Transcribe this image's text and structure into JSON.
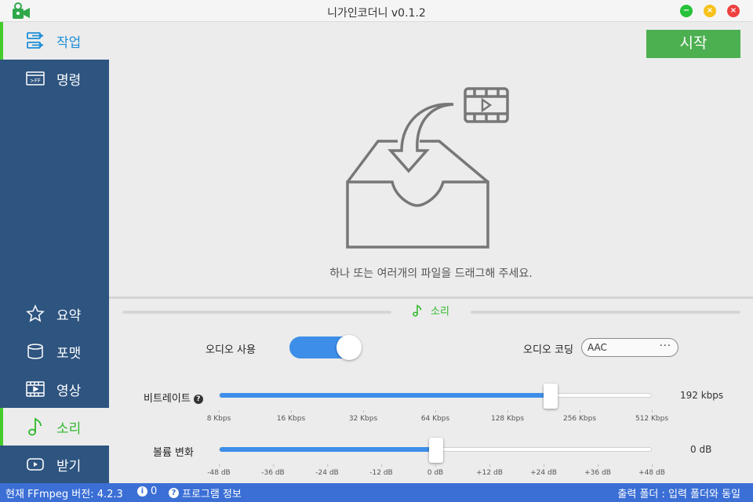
{
  "window": {
    "title": "니가인코더니 v0.1.2"
  },
  "sidebar": {
    "items": [
      {
        "label": "작업",
        "icon": "task-icon",
        "active": true
      },
      {
        "label": "명령",
        "icon": "ffmpeg-command-icon"
      },
      {
        "label": "요약",
        "icon": "star-icon"
      },
      {
        "label": "포맷",
        "icon": "database-icon"
      },
      {
        "label": "영상",
        "icon": "film-icon"
      },
      {
        "label": "소리",
        "icon": "music-note-icon",
        "active": true
      },
      {
        "label": "받기",
        "icon": "youtube-icon"
      }
    ]
  },
  "toolbar": {
    "start_label": "시작"
  },
  "dropzone": {
    "hint": "하나 또는 여러개의 파일을 드래그해 주세요."
  },
  "audio_panel": {
    "title": "소리",
    "enable_label": "오디오 사용",
    "enabled": true,
    "codec_label": "오디오 코딩",
    "codec_value": "AAC",
    "codec_more": "···",
    "bitrate": {
      "label": "비트레이트",
      "help": "?",
      "value": "192 kbps",
      "fraction": 0.765,
      "ticks": [
        "8 Kbps",
        "16 Kbps",
        "32 Kbps",
        "64 Kbps",
        "128 Kbps",
        "256 Kbps",
        "512 Kbps"
      ]
    },
    "volume": {
      "label": "볼륨 변화",
      "value": "0 dB",
      "fraction": 0.5,
      "ticks": [
        "-48 dB",
        "-36 dB",
        "-24 dB",
        "-12 dB",
        "0 dB",
        "+12 dB",
        "+24 dB",
        "+36 dB",
        "+48 dB"
      ]
    }
  },
  "statusbar": {
    "ffmpeg": "현재 FFmpeg 버전: 4.2.3",
    "info_icon": "i",
    "info_count": "0",
    "about_icon": "?",
    "about_label": "프로그램 정보",
    "output": "출력 폴더 : 입력 폴더와 동일"
  },
  "colors": {
    "sidebar": "#2e5480",
    "accent_blue": "#3d8ee8",
    "accent_green": "#4caf50",
    "statusbar": "#3b6fd6"
  }
}
